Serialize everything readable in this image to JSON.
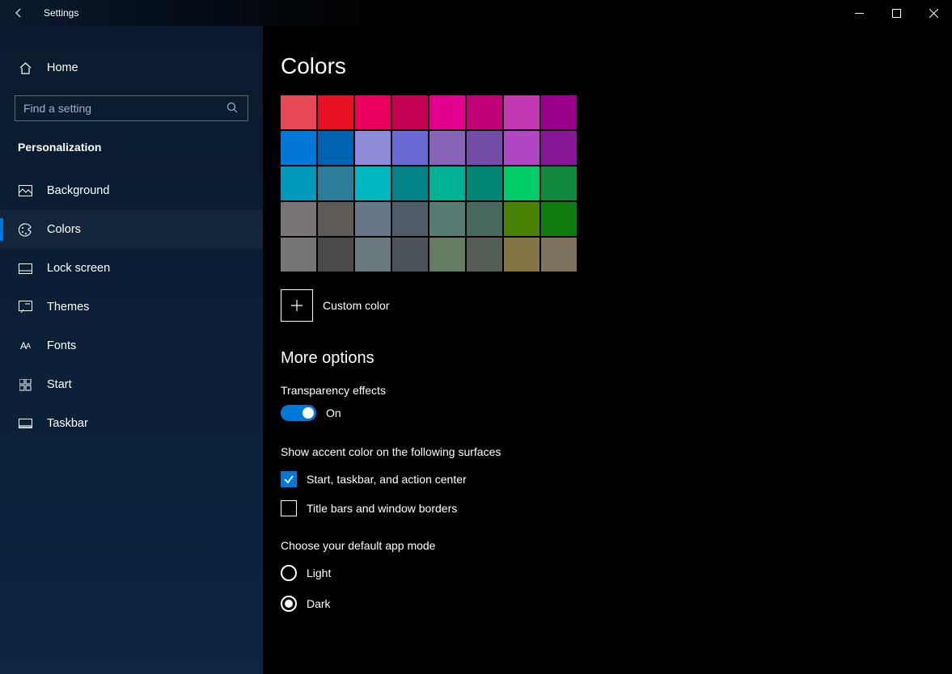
{
  "app_title": "Settings",
  "home_label": "Home",
  "search_placeholder": "Find a setting",
  "category": "Personalization",
  "nav": {
    "background": "Background",
    "colors": "Colors",
    "lockscreen": "Lock screen",
    "themes": "Themes",
    "fonts": "Fonts",
    "start": "Start",
    "taskbar": "Taskbar"
  },
  "page": {
    "title": "Colors",
    "custom_color": "Custom color",
    "more_options": "More options",
    "transparency_label": "Transparency effects",
    "transparency_value": "On",
    "accent_surfaces_label": "Show accent color on the following surfaces",
    "accent_start": "Start, taskbar, and action center",
    "accent_titlebars": "Title bars and window borders",
    "app_mode_label": "Choose your default app mode",
    "app_mode_light": "Light",
    "app_mode_dark": "Dark"
  },
  "palette": [
    "#e74856",
    "#e81123",
    "#ea005e",
    "#c30052",
    "#e3008c",
    "#bf0077",
    "#c239b3",
    "#9a0089",
    "#0078d7",
    "#0063b1",
    "#8e8cd8",
    "#6b69d6",
    "#8764b8",
    "#744da9",
    "#b146c2",
    "#881798",
    "#0099bc",
    "#2d7d9a",
    "#00b7c3",
    "#038387",
    "#00b294",
    "#018574",
    "#00cc6a",
    "#10893e",
    "#7a7574",
    "#5d5a58",
    "#68768a",
    "#515c6b",
    "#567c73",
    "#486860",
    "#498205",
    "#107c10",
    "#767676",
    "#4c4a48",
    "#69797e",
    "#4a5459",
    "#647c64",
    "#525e54",
    "#847545",
    "#7e735f"
  ]
}
